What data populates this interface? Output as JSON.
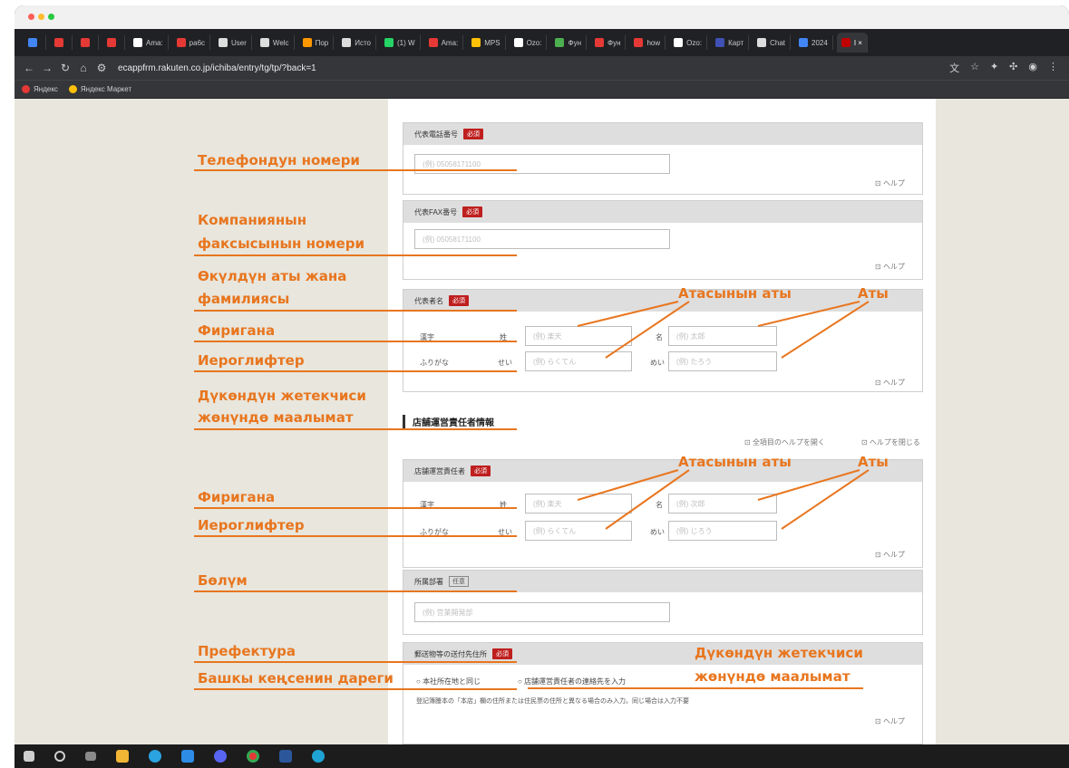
{
  "browser": {
    "tabs": [
      {
        "label": "",
        "color": "#4285f4"
      },
      {
        "label": "",
        "color": "#e53935"
      },
      {
        "label": "",
        "color": "#e53935"
      },
      {
        "label": "",
        "color": "#e53935"
      },
      {
        "label": "Ama:",
        "color": "#ffffff"
      },
      {
        "label": "ра6с",
        "color": "#e53935"
      },
      {
        "label": "User",
        "color": "#dddddd"
      },
      {
        "label": "Welc",
        "color": "#dddddd"
      },
      {
        "label": "Пор",
        "color": "#ff9800"
      },
      {
        "label": "Исто",
        "color": "#dddddd"
      },
      {
        "label": "(1) W",
        "color": "#25d366"
      },
      {
        "label": "Ama:",
        "color": "#e53935"
      },
      {
        "label": "MPS",
        "color": "#ffc107"
      },
      {
        "label": "Ozo:",
        "color": "#ffffff"
      },
      {
        "label": "Фун",
        "color": "#4caf50"
      },
      {
        "label": "Фун",
        "color": "#e53935"
      },
      {
        "label": "how",
        "color": "#e53935"
      },
      {
        "label": "Ozo:",
        "color": "#ffffff"
      },
      {
        "label": "Карт",
        "color": "#3f51b5"
      },
      {
        "label": "Chat",
        "color": "#dddddd"
      },
      {
        "label": "2024",
        "color": "#4285f4"
      },
      {
        "label": "I ×",
        "color": "#bf0000",
        "active": true
      }
    ],
    "url": "ecappfrm.rakuten.co.jp/ichiba/entry/tg/tp/?back=1",
    "bookmarks": [
      {
        "label": "Яндекс",
        "color": "#e53935"
      },
      {
        "label": "Яндекс Маркет",
        "color": "#ffc107"
      }
    ]
  },
  "form": {
    "phone": {
      "title": "代表電話番号",
      "badge": "必須",
      "placeholder": "(例) 05058171100",
      "help": "ヘルプ"
    },
    "fax": {
      "title": "代表FAX番号",
      "badge": "必須",
      "placeholder": "(例) 05058171100",
      "help": "ヘルプ"
    },
    "rep": {
      "title": "代表者名",
      "badge": "必須",
      "kanji_label": "漢字",
      "sei": "姓",
      "mei": "名",
      "kanji_last_ph": "(例) 楽天",
      "kanji_first_ph": "(例) 太郎",
      "furi_label": "ふりがな",
      "sei_kana": "せい",
      "mei_kana": "めい",
      "furi_last_ph": "(例) らくてん",
      "furi_first_ph": "(例) たろう",
      "help": "ヘルプ"
    },
    "store_section_title": "店舗運営責任者情報",
    "expand_all": "全項目のヘルプを開く",
    "collapse_all": "ヘルプを閉じる",
    "manager": {
      "title": "店舗運営責任者",
      "badge": "必須",
      "kanji_label": "漢字",
      "sei": "姓",
      "mei": "名",
      "kanji_last_ph": "(例) 楽天",
      "kanji_first_ph": "(例) 次郎",
      "furi_label": "ふりがな",
      "sei_kana": "せい",
      "mei_kana": "めい",
      "furi_last_ph": "(例) らくてん",
      "furi_first_ph": "(例) じろう",
      "help": "ヘルプ"
    },
    "dept": {
      "title": "所属部署",
      "badge": "任意",
      "placeholder": "(例) 営業開発部"
    },
    "address": {
      "title": "郵送物等の送付先住所",
      "badge": "必須",
      "radio1": "本社所在地と同じ",
      "radio2": "店舗運営責任者の連絡先を入力",
      "note": "登記簿謄本の「本店」欄の住所または住民票の住所と異なる場合のみ入力。同じ場合は入力不要",
      "help": "ヘルプ"
    }
  },
  "annotations": {
    "phone": "Телефондун номери",
    "fax_1": "Компаниянын",
    "fax_2": "факсысынын номери",
    "rep_1": "Өкүлдүн аты жана",
    "rep_2": "фамилиясы",
    "furigana": "Фиригана",
    "kanji": "Иероглифтер",
    "store_1": "Дүкөндүн жетекчиси",
    "store_2": "жөнүндө маалымат",
    "last_name": "Атасынын аты",
    "first_name": "Аты",
    "dept": "Бөлүм",
    "prefecture": "Префектура",
    "other_office": "Башкы кеңсенин дареги",
    "store_info_1": "Дүкөндүн жетекчиси",
    "store_info_2": "жөнүндө маалымат"
  },
  "colors": {
    "accent": "#e8761f",
    "required_badge": "#bf1f1f",
    "page_bg": "#e8e6dd"
  }
}
